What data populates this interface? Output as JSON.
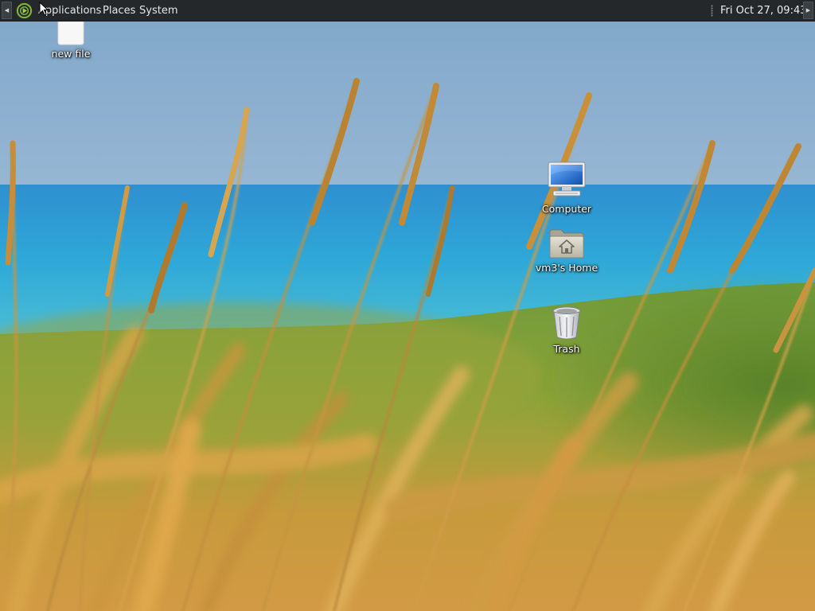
{
  "panel": {
    "menus": {
      "applications": "Applications",
      "places": "Places",
      "system": "System"
    },
    "clock": "Fri Oct 27, 09:43",
    "background_color": "#24282b"
  },
  "desktop": {
    "wallpaper": "grass-dunes-seascape",
    "icons": [
      {
        "id": "new-file",
        "label": "new file",
        "icon": "blank-file-icon"
      },
      {
        "id": "computer",
        "label": "Computer",
        "icon": "computer-icon"
      },
      {
        "id": "home",
        "label": "vm3's Home",
        "icon": "home-folder-icon"
      },
      {
        "id": "trash",
        "label": "Trash",
        "icon": "trash-icon"
      }
    ]
  }
}
